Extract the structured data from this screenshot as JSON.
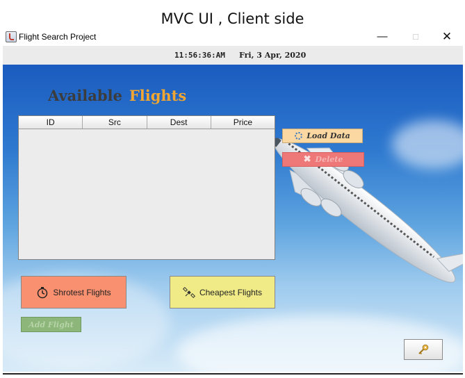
{
  "caption": "MVC UI , Client side",
  "window": {
    "title": "Flight Search Project",
    "icon": "java-cup-icon"
  },
  "status": {
    "time": "11:56:36:AM",
    "date": "Fri, 3 Apr, 2020"
  },
  "heading": {
    "word1": "Available",
    "word2": "Flights",
    "color1": "#3c3c3c",
    "color2": "#f0a630"
  },
  "table": {
    "columns": [
      "ID",
      "Src",
      "Dest",
      "Price"
    ],
    "rows": []
  },
  "buttons": {
    "load": {
      "label": "Load Data",
      "icon": "loading-spinner-icon"
    },
    "delete": {
      "label": "Delete",
      "icon": "x-icon",
      "enabled": false
    },
    "shortest": {
      "label": "Shrotest Flights",
      "icon": "stopwatch-icon"
    },
    "cheapest": {
      "label": "Cheapest Flights",
      "icon": "satellite-icon"
    },
    "add": {
      "label": "Add Flight",
      "enabled": false
    },
    "key": {
      "icon": "key-icon"
    }
  },
  "colors": {
    "load": "#fbd7a2",
    "delete": "#ee7777",
    "shortest": "#f9906f",
    "cheapest": "#f0eb86",
    "add": "#8db67a"
  }
}
